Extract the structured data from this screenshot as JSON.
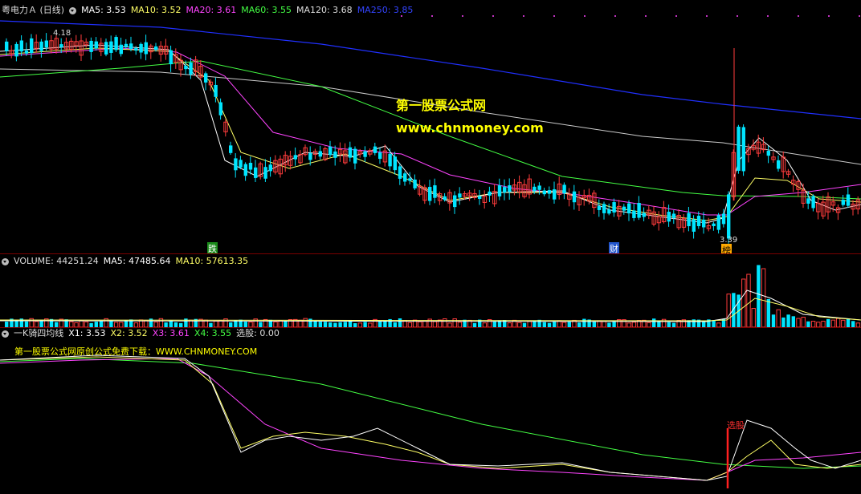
{
  "main_legend": {
    "title": "粤电力Ａ (日线)",
    "ma5": "MA5: 3.53",
    "ma10": "MA10: 3.52",
    "ma20": "MA20: 3.61",
    "ma60": "MA60: 3.55",
    "ma120": "MA120: 3.68",
    "ma250": "MA250: 3.85"
  },
  "price_high_label": "4.18",
  "price_low_label": "3.39",
  "watermark": {
    "line1": "第一股票公式网",
    "line2": "www.chnmoney.com"
  },
  "event_tags": [
    {
      "text": "跌",
      "color": "#22aa22"
    },
    {
      "text": "财",
      "color": "#4477ff"
    },
    {
      "text": "榜",
      "color": "#ffaa00"
    }
  ],
  "volume_legend": {
    "title": "VOLUME: 44251.24",
    "ma5": "MA5: 47485.64",
    "ma10": "MA10: 57613.35"
  },
  "indicator_legend": {
    "title": "一K骑四均线",
    "x1": "X1: 3.53",
    "x2": "X2: 3.52",
    "x3": "X3: 3.61",
    "x4": "X4: 3.55",
    "xg": "选股: 0.00"
  },
  "indicator_note": "第一股票公式网原创公式免费下载：WWW.CHNMONEY.COM",
  "signal_label": "选股",
  "colors": {
    "up": "#ff3c3c",
    "down": "#00e5ff",
    "ma5": "#ffffff",
    "ma10": "#ffff66",
    "ma20": "#ff44ff",
    "ma60": "#44ff44",
    "ma120": "#cccccc",
    "ma250": "#2030ff"
  }
}
